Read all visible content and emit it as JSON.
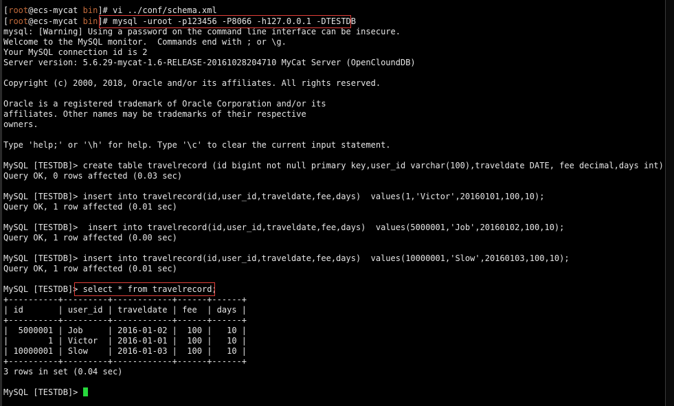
{
  "colors": {
    "background": "#000000",
    "text": "#e6e6e6",
    "prompt_root": "#c46c3c",
    "highlight_border": "#e4403a",
    "cursor": "#27d83c"
  },
  "terminal": {
    "line01": {
      "bracket_open": "[",
      "user": "root",
      "host": "@ecs-mycat ",
      "dir": "bin",
      "prompt_end": "]#",
      "command": " vi ../conf/schema.xml"
    },
    "line02": {
      "bracket_open": "[",
      "user": "root",
      "host": "@ecs-mycat ",
      "dir": "bin",
      "prompt_end": "]#",
      "command": " mysql -uroot -p123456 -P8066 -h127.0.0.1 -DTESTDB"
    },
    "line03": "mysql: [Warning] Using a password on the command line interface can be insecure.",
    "line04": "Welcome to the MySQL monitor.  Commands end with ; or \\g.",
    "line05": "Your MySQL connection id is 2",
    "line06": "Server version: 5.6.29-mycat-1.6-RELEASE-20161028204710 MyCat Server (OpenCloundDB)",
    "line07": "",
    "line08": "Copyright (c) 2000, 2018, Oracle and/or its affiliates. All rights reserved.",
    "line09": "",
    "line10": "Oracle is a registered trademark of Oracle Corporation and/or its",
    "line11": "affiliates. Other names may be trademarks of their respective",
    "line12": "owners.",
    "line13": "",
    "line14": "Type 'help;' or '\\h' for help. Type '\\c' to clear the current input statement.",
    "line15": "",
    "line16": "MySQL [TESTDB]> create table travelrecord (id bigint not null primary key,user_id varchar(100),traveldate DATE, fee decimal,days int);",
    "line17": "Query OK, 0 rows affected (0.03 sec)",
    "line18": "",
    "line19": "MySQL [TESTDB]> insert into travelrecord(id,user_id,traveldate,fee,days)  values(1,'Victor',20160101,100,10);",
    "line20": "Query OK, 1 row affected (0.01 sec)",
    "line21": "",
    "line22": "MySQL [TESTDB]>  insert into travelrecord(id,user_id,traveldate,fee,days)  values(5000001,'Job',20160102,100,10);",
    "line23": "Query OK, 1 row affected (0.00 sec)",
    "line24": "",
    "line25": "MySQL [TESTDB]> insert into travelrecord(id,user_id,traveldate,fee,days)  values(10000001,'Slow',20160103,100,10);",
    "line26": "Query OK, 1 row affected (0.01 sec)",
    "line27": "",
    "line28": {
      "prompt": "MySQL [TESTDB]> ",
      "command": "select * from travelrecord;"
    },
    "line29": "+----------+---------+------------+------+------+",
    "line30": "| id       | user_id | traveldate | fee  | days |",
    "line31": "+----------+---------+------------+------+------+",
    "line32": "|  5000001 | Job     | 2016-01-02 |  100 |   10 |",
    "line33": "|        1 | Victor  | 2016-01-01 |  100 |   10 |",
    "line34": "| 10000001 | Slow    | 2016-01-03 |  100 |   10 |",
    "line35": "+----------+---------+------------+------+------+",
    "line36": "3 rows in set (0.04 sec)",
    "line37": "",
    "line38": {
      "prompt": "MySQL [TESTDB]> "
    }
  }
}
